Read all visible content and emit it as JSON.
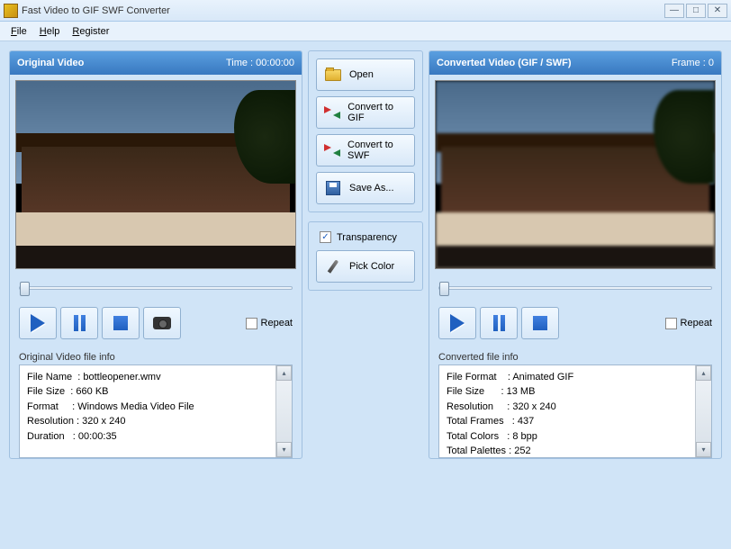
{
  "window": {
    "title": "Fast Video to GIF SWF Converter"
  },
  "menu": {
    "file": "File",
    "help": "Help",
    "register": "Register"
  },
  "left": {
    "title": "Original Video",
    "time_label": "Time : 00:00:00",
    "repeat": "Repeat",
    "info_label": "Original Video file info",
    "info_text": "File Name  : bottleopener.wmv\nFile Size  : 660 KB\nFormat     : Windows Media Video File\nResolution : 320 x 240\nDuration   : 00:00:35"
  },
  "center": {
    "open": "Open",
    "to_gif": "Convert to GIF",
    "to_swf": "Convert to SWF",
    "save_as": "Save As...",
    "transparency": "Transparency",
    "pick_color": "Pick Color"
  },
  "right": {
    "title": "Converted Video (GIF / SWF)",
    "frame_label": "Frame : 0",
    "repeat": "Repeat",
    "info_label": "Converted file info",
    "info_text": "File Format    : Animated GIF\nFile Size      : 13 MB\nResolution     : 320 x 240\nTotal Frames   : 437\nTotal Colors   : 8 bpp\nTotal Palettes : 252"
  }
}
